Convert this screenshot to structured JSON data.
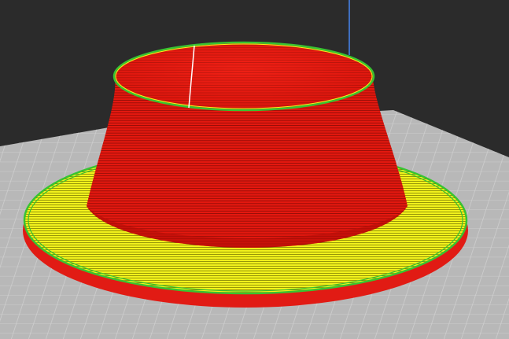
{
  "viewport": {
    "view": "3d-layer-preview",
    "background_color": "#2b2b2b",
    "bed_color": "#b8b8b8",
    "grid_color": "#cfcfcf",
    "axis_color": "#3f6fbf"
  },
  "model": {
    "name": "",
    "feature_colors": {
      "outer_wall": "#e11b14",
      "outer_wall_edge": "#c80f0a",
      "top_bottom_skin": "#f5f51a",
      "inner_wall": "#38c430"
    },
    "shape": "truncated-cone-with-brim"
  }
}
